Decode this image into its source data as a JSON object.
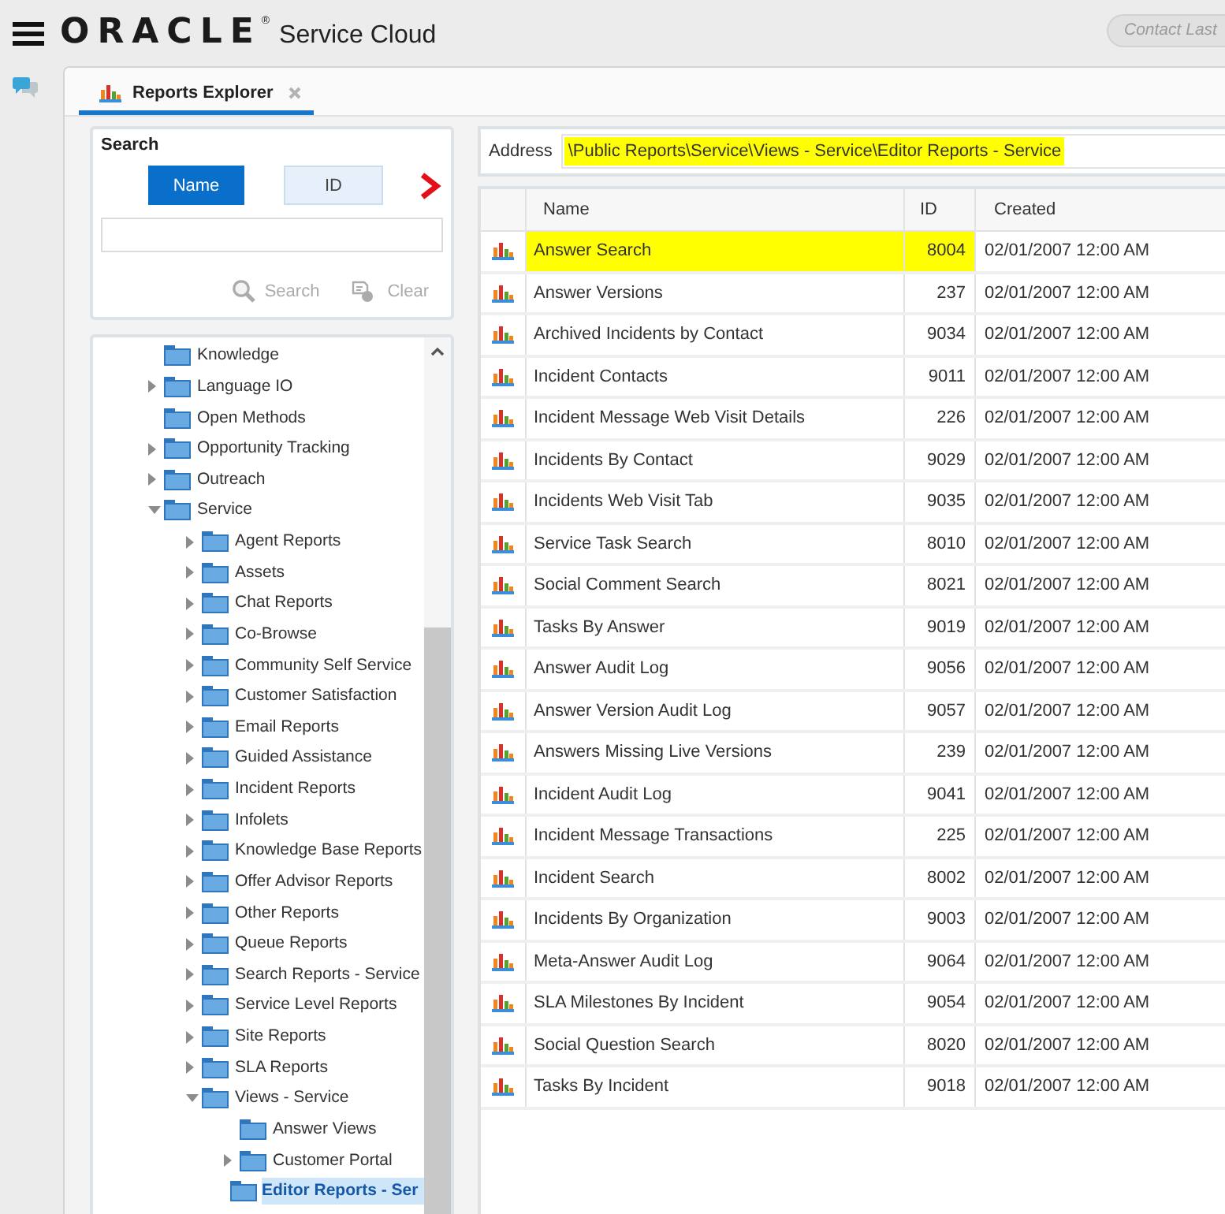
{
  "header": {
    "logo": "ORACLE",
    "logo_mark": "®",
    "product": "Service Cloud",
    "contact_button": "Contact Last"
  },
  "tabs": [
    {
      "label": "Reports Explorer",
      "selected": true
    }
  ],
  "search": {
    "title": "Search",
    "modes": [
      {
        "label": "Name",
        "selected": true
      },
      {
        "label": "ID",
        "selected": false
      }
    ],
    "actions": [
      {
        "kind": "search",
        "label": "Search",
        "disabled": true
      },
      {
        "kind": "clear",
        "label": "Clear",
        "disabled": true
      }
    ]
  },
  "tree": {
    "items": [
      {
        "label": "Knowledge",
        "kind": "leaf",
        "selected": false
      },
      {
        "label": "Language IO",
        "kind": "branch",
        "expanded": false,
        "selected": false
      },
      {
        "label": "Open Methods",
        "kind": "leaf",
        "selected": false
      },
      {
        "label": "Opportunity Tracking",
        "kind": "branch",
        "expanded": false,
        "selected": false
      },
      {
        "label": "Outreach",
        "kind": "branch",
        "expanded": false,
        "selected": false
      },
      {
        "label": "Service",
        "kind": "branch",
        "expanded": true,
        "selected": false,
        "children": [
          {
            "label": "Agent Reports",
            "kind": "branch",
            "expanded": false,
            "selected": false
          },
          {
            "label": "Assets",
            "kind": "branch",
            "expanded": false,
            "selected": false
          },
          {
            "label": "Chat Reports",
            "kind": "branch",
            "expanded": false,
            "selected": false
          },
          {
            "label": "Co-Browse",
            "kind": "branch",
            "expanded": false,
            "selected": false
          },
          {
            "label": "Community Self Service",
            "kind": "branch",
            "expanded": false,
            "selected": false
          },
          {
            "label": "Customer Satisfaction",
            "kind": "branch",
            "expanded": false,
            "selected": false
          },
          {
            "label": "Email Reports",
            "kind": "branch",
            "expanded": false,
            "selected": false
          },
          {
            "label": "Guided Assistance",
            "kind": "branch",
            "expanded": false,
            "selected": false
          },
          {
            "label": "Incident Reports",
            "kind": "branch",
            "expanded": false,
            "selected": false
          },
          {
            "label": "Infolets",
            "kind": "branch",
            "expanded": false,
            "selected": false
          },
          {
            "label": "Knowledge Base Reports",
            "kind": "branch",
            "expanded": false,
            "selected": false
          },
          {
            "label": "Offer Advisor Reports",
            "kind": "branch",
            "expanded": false,
            "selected": false
          },
          {
            "label": "Other Reports",
            "kind": "branch",
            "expanded": false,
            "selected": false
          },
          {
            "label": "Queue Reports",
            "kind": "branch",
            "expanded": false,
            "selected": false
          },
          {
            "label": "Search Reports - Service",
            "kind": "branch",
            "expanded": false,
            "selected": false
          },
          {
            "label": "Service Level Reports",
            "kind": "branch",
            "expanded": false,
            "selected": false
          },
          {
            "label": "Site Reports",
            "kind": "branch",
            "expanded": false,
            "selected": false
          },
          {
            "label": "SLA Reports",
            "kind": "branch",
            "expanded": false,
            "selected": false
          },
          {
            "label": "Views - Service",
            "kind": "branch",
            "expanded": true,
            "selected": false,
            "children": [
              {
                "label": "Answer Views",
                "kind": "leaf",
                "selected": false
              },
              {
                "label": "Customer Portal",
                "kind": "branch",
                "expanded": false,
                "selected": false
              },
              {
                "label": "Editor Reports - Ser",
                "kind": "leaf",
                "selected": true
              }
            ]
          }
        ]
      }
    ]
  },
  "address": {
    "label": "Address",
    "value": "\\Public Reports\\Service\\Views - Service\\Editor Reports - Service",
    "highlighted": true
  },
  "table": {
    "columns": [
      "Name",
      "ID",
      "Created"
    ],
    "rows": [
      {
        "name": "Answer Search",
        "id": "8004",
        "created": "02/01/2007 12:00 AM",
        "highlighted": true
      },
      {
        "name": "Answer Versions",
        "id": "237",
        "created": "02/01/2007 12:00 AM",
        "highlighted": false
      },
      {
        "name": "Archived Incidents by Contact",
        "id": "9034",
        "created": "02/01/2007 12:00 AM",
        "highlighted": false
      },
      {
        "name": "Incident Contacts",
        "id": "9011",
        "created": "02/01/2007 12:00 AM",
        "highlighted": false
      },
      {
        "name": "Incident Message Web Visit Details",
        "id": "226",
        "created": "02/01/2007 12:00 AM",
        "highlighted": false
      },
      {
        "name": "Incidents By Contact",
        "id": "9029",
        "created": "02/01/2007 12:00 AM",
        "highlighted": false
      },
      {
        "name": "Incidents Web Visit Tab",
        "id": "9035",
        "created": "02/01/2007 12:00 AM",
        "highlighted": false
      },
      {
        "name": "Service Task Search",
        "id": "8010",
        "created": "02/01/2007 12:00 AM",
        "highlighted": false
      },
      {
        "name": "Social Comment Search",
        "id": "8021",
        "created": "02/01/2007 12:00 AM",
        "highlighted": false
      },
      {
        "name": "Tasks By Answer",
        "id": "9019",
        "created": "02/01/2007 12:00 AM",
        "highlighted": false
      },
      {
        "name": "Answer Audit Log",
        "id": "9056",
        "created": "02/01/2007 12:00 AM",
        "highlighted": false
      },
      {
        "name": "Answer Version Audit Log",
        "id": "9057",
        "created": "02/01/2007 12:00 AM",
        "highlighted": false
      },
      {
        "name": "Answers Missing Live Versions",
        "id": "239",
        "created": "02/01/2007 12:00 AM",
        "highlighted": false
      },
      {
        "name": "Incident Audit Log",
        "id": "9041",
        "created": "02/01/2007 12:00 AM",
        "highlighted": false
      },
      {
        "name": "Incident Message Transactions",
        "id": "225",
        "created": "02/01/2007 12:00 AM",
        "highlighted": false
      },
      {
        "name": "Incident Search",
        "id": "8002",
        "created": "02/01/2007 12:00 AM",
        "highlighted": false
      },
      {
        "name": "Incidents By Organization",
        "id": "9003",
        "created": "02/01/2007 12:00 AM",
        "highlighted": false
      },
      {
        "name": "Meta-Answer Audit Log",
        "id": "9064",
        "created": "02/01/2007 12:00 AM",
        "highlighted": false
      },
      {
        "name": "SLA Milestones By Incident",
        "id": "9054",
        "created": "02/01/2007 12:00 AM",
        "highlighted": false
      },
      {
        "name": "Social Question Search",
        "id": "8020",
        "created": "02/01/2007 12:00 AM",
        "highlighted": false
      },
      {
        "name": "Tasks By Incident",
        "id": "9018",
        "created": "02/01/2007 12:00 AM",
        "highlighted": false
      }
    ]
  }
}
